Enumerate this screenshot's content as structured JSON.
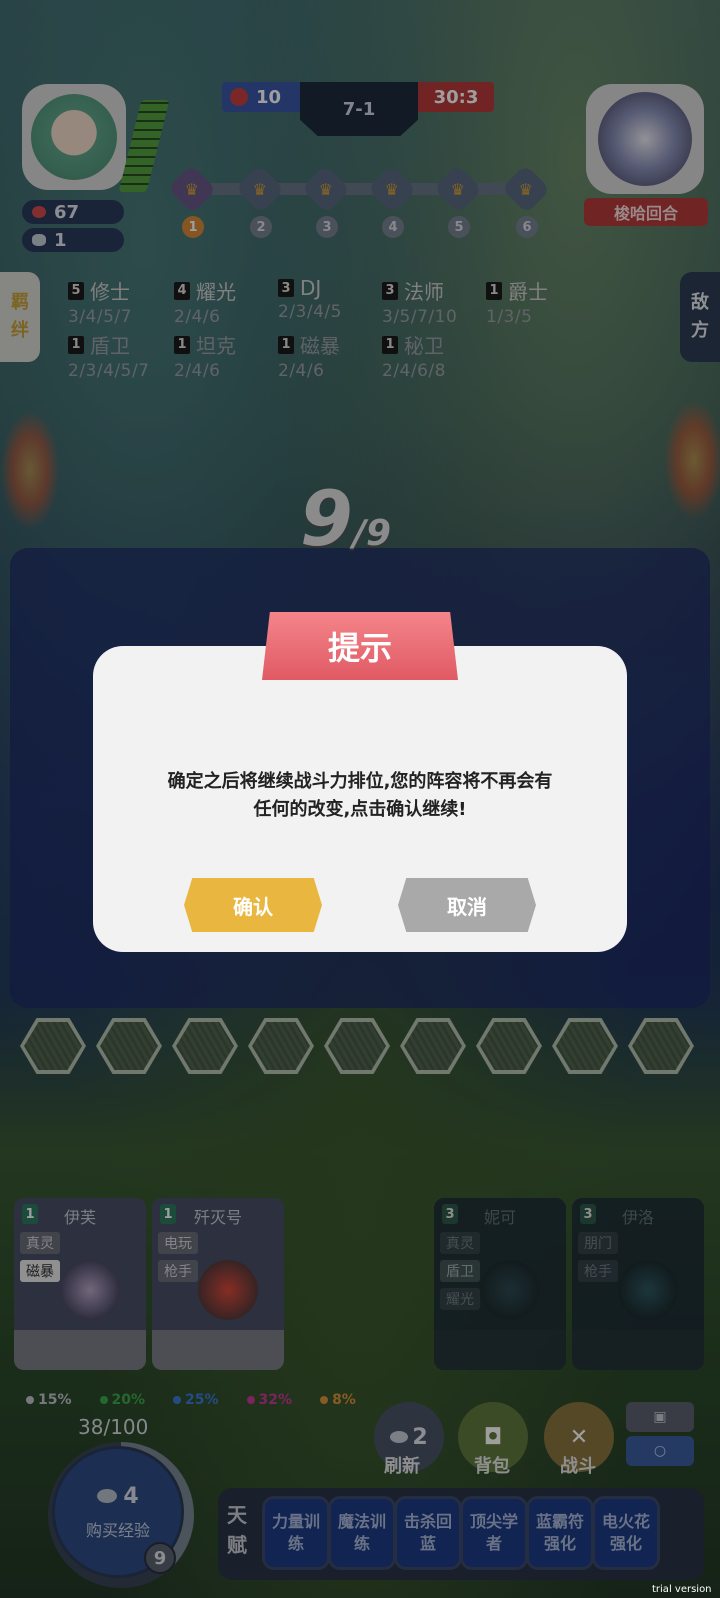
{
  "player": {
    "hp": "67",
    "coins": "1"
  },
  "scoreboard": {
    "blue_score": "10",
    "round": "7-1",
    "red_score": "30:3"
  },
  "enemy": {
    "name": "梭哈回合"
  },
  "stages": [
    "1",
    "2",
    "3",
    "4",
    "5",
    "6"
  ],
  "side_tabs": {
    "left": [
      "羁",
      "绊"
    ],
    "right": [
      "敌",
      "方"
    ]
  },
  "traits": [
    {
      "level": "5",
      "name": "修士",
      "steps": "3/4/5/7"
    },
    {
      "level": "4",
      "name": "耀光",
      "steps": "2/4/6"
    },
    {
      "level": "3",
      "name": "DJ",
      "steps": "2/3/4/5"
    },
    {
      "level": "3",
      "name": "法师",
      "steps": "3/5/7/10"
    },
    {
      "level": "1",
      "name": "爵士",
      "steps": "1/3/5"
    },
    {
      "level": "1",
      "name": "盾卫",
      "steps": "2/3/4/5/7"
    },
    {
      "level": "1",
      "name": "坦克",
      "steps": "2/4/6"
    },
    {
      "level": "1",
      "name": "磁暴",
      "steps": "2/4/6"
    },
    {
      "level": "1",
      "name": "秘卫",
      "steps": "2/4/6/8"
    }
  ],
  "timer": {
    "current": "9",
    "total": "/9"
  },
  "dialog": {
    "title": "提示",
    "message_line1": "确定之后将继续战斗力排位,您的阵容将不再会有",
    "message_line2": "任何的改变,点击确认继续!",
    "confirm_label": "确认",
    "cancel_label": "取消"
  },
  "shop": [
    {
      "cost": "1",
      "name": "伊芙",
      "tags": [
        "真灵",
        "磁暴"
      ]
    },
    {
      "cost": "1",
      "name": "歼灭号",
      "tags": [
        "电玩",
        "枪手"
      ]
    },
    {
      "cost": "3",
      "name": "妮可",
      "tags": [
        "真灵",
        "盾卫",
        "耀光"
      ]
    },
    {
      "cost": "3",
      "name": "伊洛",
      "tags": [
        "朋门",
        "枪手"
      ]
    }
  ],
  "odds": [
    {
      "value": "15%",
      "color": "#c0c4cc"
    },
    {
      "value": "20%",
      "color": "#3aa84a"
    },
    {
      "value": "25%",
      "color": "#3a7ad8"
    },
    {
      "value": "32%",
      "color": "#c83a9a"
    },
    {
      "value": "8%",
      "color": "#d8943a"
    }
  ],
  "xp": {
    "label": "38/100",
    "progress": 0.38,
    "cost": "4",
    "button_label": "购买经验",
    "level": "9"
  },
  "actions": {
    "refresh_cost": "2",
    "refresh_label": "刷新",
    "bag_label": "背包",
    "fight_label": "战斗"
  },
  "talents": {
    "heading": [
      "天",
      "赋"
    ],
    "items": [
      "力量训练",
      "魔法训练",
      "击杀回蓝",
      "顶尖学者",
      "蓝霸符强化",
      "电火花强化"
    ]
  },
  "watermark": "trial version"
}
